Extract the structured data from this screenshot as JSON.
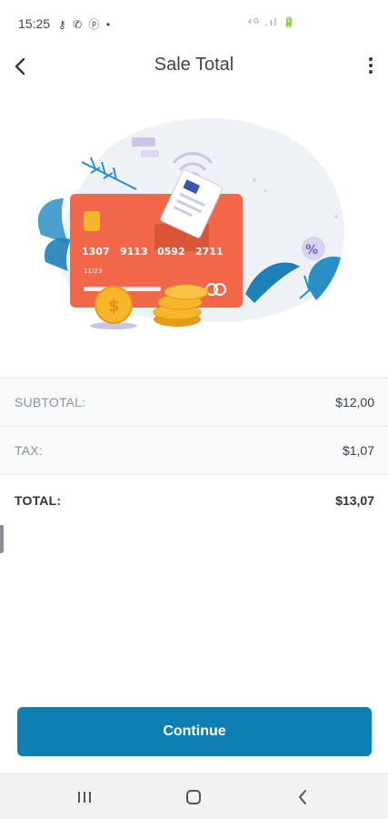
{
  "status_bar": {
    "time": "15:25",
    "left_icons": "⚷ ✆ ⓟ •",
    "right_icons": "⁴ᴳ .ıl 🔋"
  },
  "app_bar": {
    "title": "Sale Total",
    "back_icon": "chevron-left-icon",
    "menu_icon": "more-vertical-icon"
  },
  "illustration": {
    "card_number": [
      "1307",
      "9113",
      "0592",
      "2711"
    ],
    "card_expiry": "11/23",
    "coin_symbol": "$",
    "badge_symbol": "%",
    "colors": {
      "card": "#f2674a",
      "blob": "#eef1f5",
      "leaf": "#2b8fc7",
      "coin": "#f6b52b"
    }
  },
  "totals": {
    "rows": [
      {
        "label": "SUBTOTAL:",
        "value": "$12,00"
      },
      {
        "label": "TAX:",
        "value": "$1,07"
      },
      {
        "label": "TOTAL:",
        "value": "$13,07"
      }
    ]
  },
  "actions": {
    "continue_label": "Continue",
    "accent_color": "#0d7fb3"
  },
  "nav_bar": {
    "recents_icon": "recents-icon",
    "home_icon": "home-icon",
    "back_icon": "back-icon"
  }
}
